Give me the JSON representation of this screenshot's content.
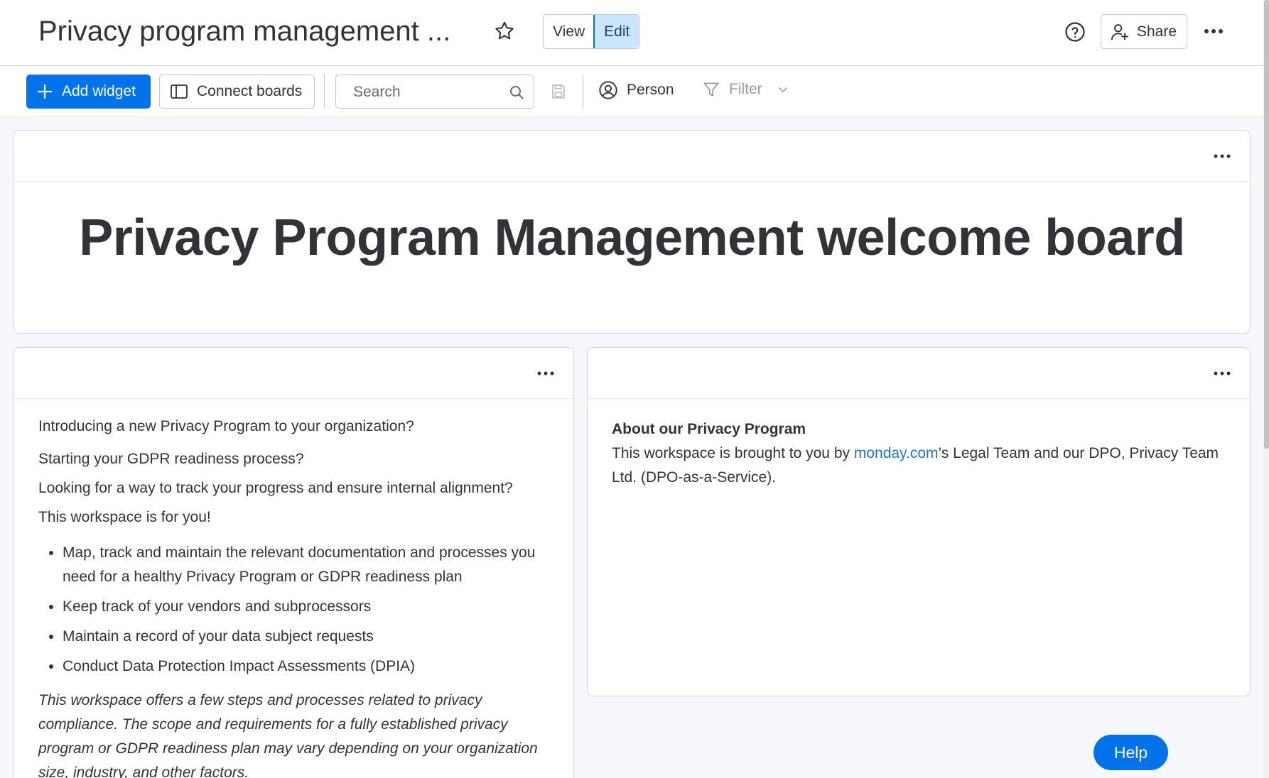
{
  "header": {
    "title": "Privacy program management ...",
    "view_label": "View",
    "edit_label": "Edit",
    "share_label": "Share"
  },
  "toolbar": {
    "add_widget_label": "Add widget",
    "connect_boards_label": "Connect boards",
    "search_placeholder": "Search",
    "person_label": "Person",
    "filter_label": "Filter"
  },
  "hero": {
    "title": "Privacy Program Management welcome board"
  },
  "left_widget": {
    "intro": "Introducing a new Privacy Program to your organization?",
    "p2": "Starting your GDPR readiness process?",
    "p3": "Looking for a way to track your progress and ensure internal alignment?",
    "p4": "This workspace is for you!",
    "bullets": [
      "Map, track and maintain the relevant documentation and processes you need for a healthy Privacy Program or GDPR readiness plan",
      "Keep track of your vendors and subprocessors",
      "Maintain a record of your data subject requests",
      "Conduct Data Protection Impact Assessments (DPIA)"
    ],
    "italic_text": "This workspace offers a few steps and processes related to privacy compliance. The scope and requirements for a fully established privacy program or GDPR readiness plan may vary depending on your organization size, industry, and other factors."
  },
  "right_widget": {
    "heading": "About our Privacy Program",
    "text_before": "This workspace is brought to you by ",
    "link_text": "monday.com",
    "text_after": "’s Legal Team and our DPO, Privacy Team Ltd. (DPO-as-a-Service)."
  },
  "help_label": "Help",
  "colors": {
    "primary": "#0073ea",
    "text": "#323338",
    "border": "#d0d4e4",
    "edit_active_bg": "#cce5ff",
    "link": "#1f76c2"
  }
}
